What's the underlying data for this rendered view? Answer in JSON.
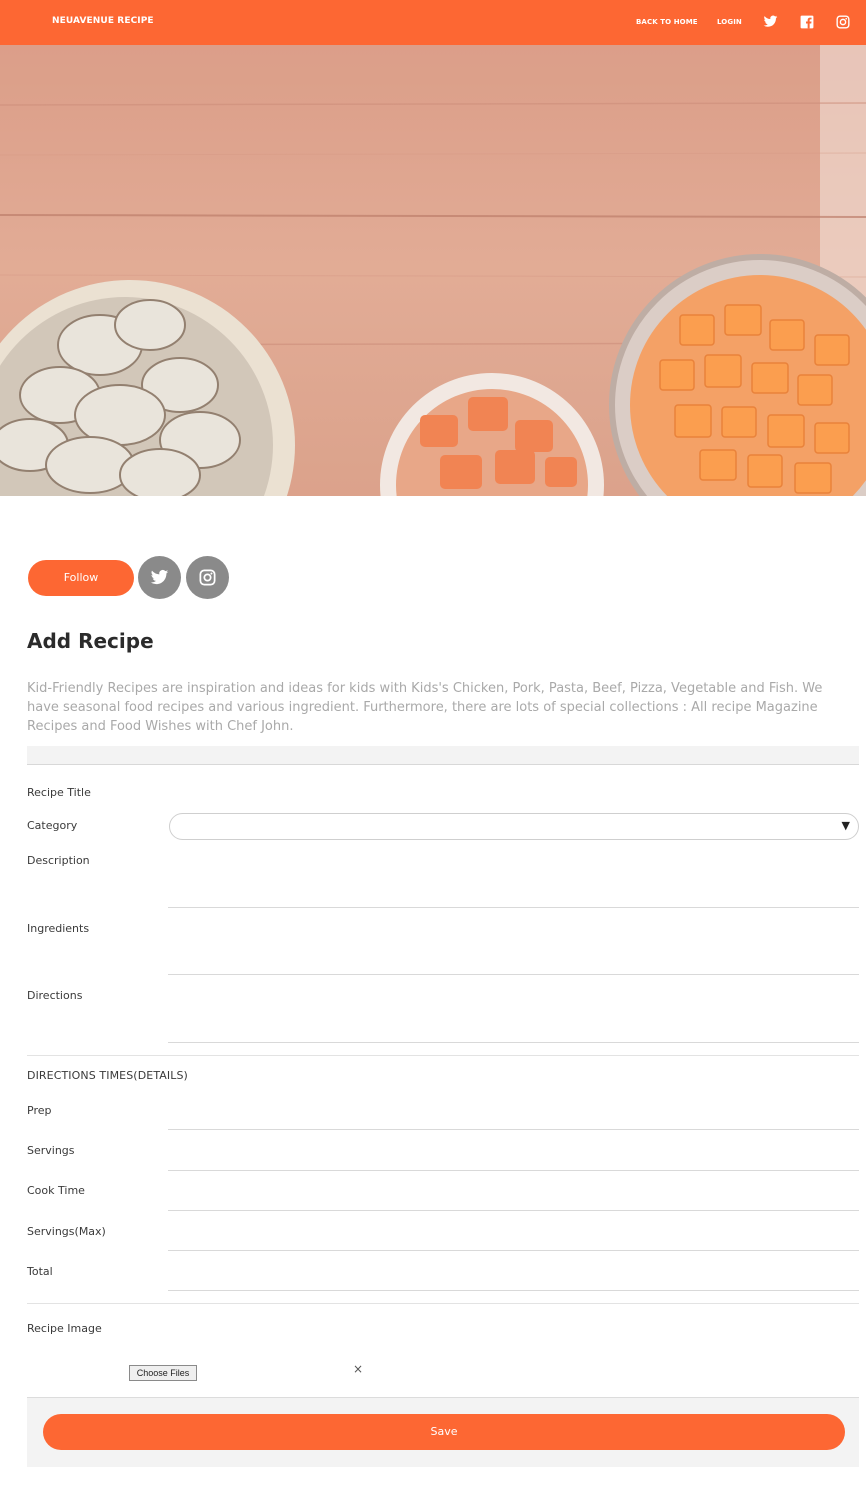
{
  "header": {
    "brand": "NEUAVENUE RECIPE",
    "nav": {
      "back_to_home": "BACK TO HOME",
      "login": "LOGIN"
    },
    "icons": [
      "twitter-icon",
      "facebook-icon",
      "instagram-icon"
    ],
    "background_color": "#fd6733"
  },
  "profile": {
    "follow_label": "Follow",
    "social_icons": [
      "twitter-icon",
      "instagram-icon"
    ]
  },
  "page": {
    "title": "Add Recipe",
    "intro": "Kid-Friendly Recipes are inspiration and ideas for kids with Kids's Chicken, Pork, Pasta, Beef, Pizza, Vegetable and Fish. We have seasonal food recipes and various ingredient. Furthermore, there are lots of special collections : All recipe Magazine Recipes and Food Wishes with Chef John."
  },
  "form": {
    "recipe_title_label": "Recipe Title",
    "recipe_title_value": "",
    "category_label": "Category",
    "category_value": "",
    "description_label": "Description",
    "description_value": "",
    "ingredients_label": "Ingredients",
    "ingredients_value": "",
    "directions_label": "Directions",
    "directions_value": "",
    "times_section_label": "DIRECTIONS TIMES(DETAILS)",
    "prep_label": "Prep",
    "servings_label": "Servings",
    "cook_time_label": "Cook Time",
    "servings_max_label": "Servings(Max)",
    "total_label": "Total",
    "recipe_image_label": "Recipe Image",
    "choose_files_label": "Choose Files",
    "clear_label": "×",
    "save_label": "Save"
  },
  "colors": {
    "accent": "#fd6733",
    "icon_circle": "#8a8a8a",
    "intro_text": "#a9a9a9"
  }
}
